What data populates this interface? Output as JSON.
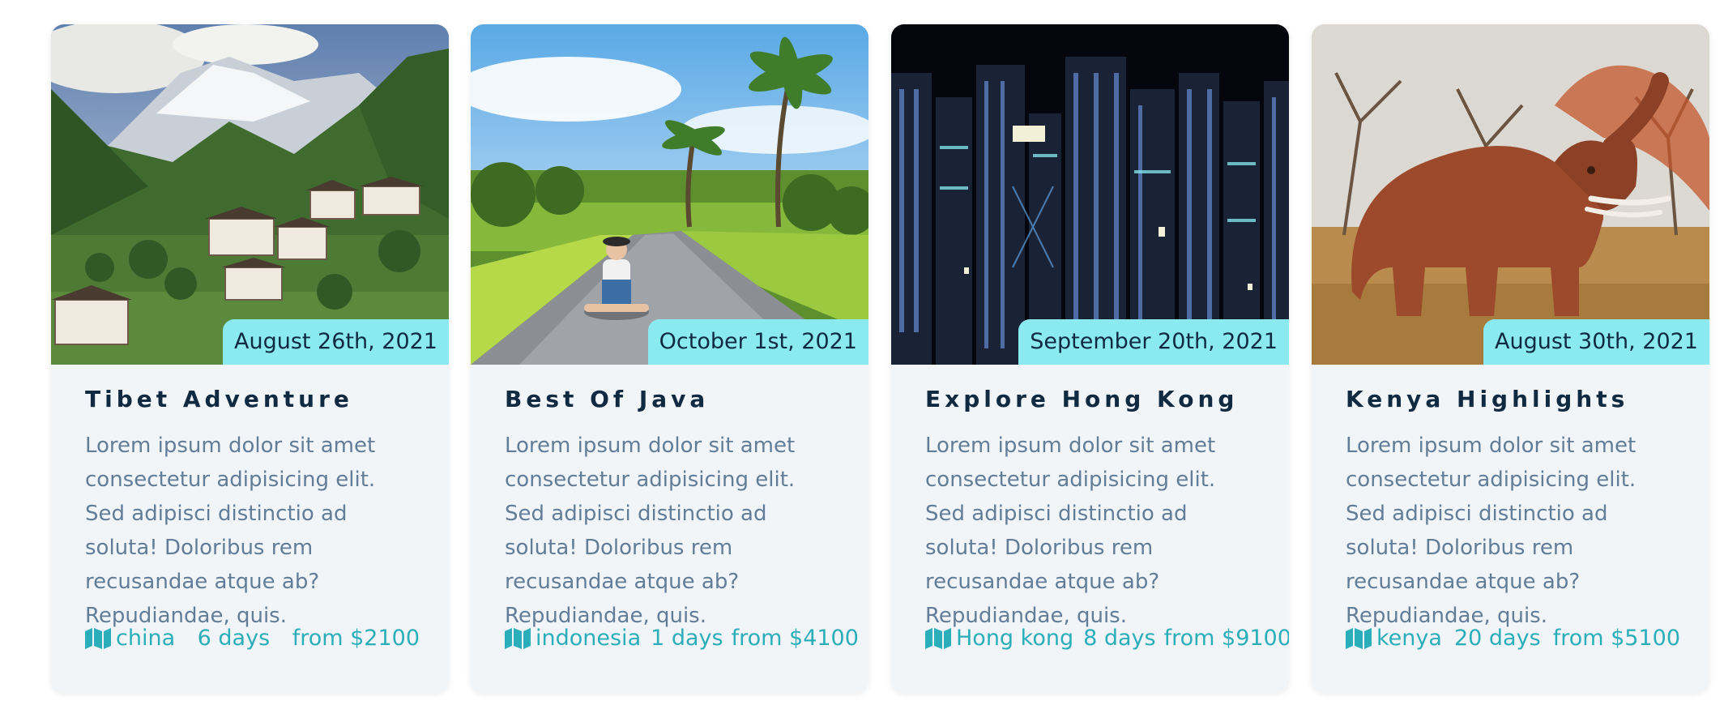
{
  "tours": [
    {
      "date": "August 26th, 2021",
      "title": "Tibet Adventure",
      "description": "Lorem ipsum dolor sit amet consectetur adipisicing elit. Sed adipisci distinctio ad soluta! Doloribus rem recusandae atque ab? Repudiandae, quis.",
      "location": "china",
      "duration": "6 days",
      "price": "from $2100",
      "image_icon": "mountain-village-image"
    },
    {
      "date": "October 1st, 2021",
      "title": "Best Of Java",
      "description": "Lorem ipsum dolor sit amet consectetur adipisicing elit. Sed adipisci distinctio ad soluta! Doloribus rem recusandae atque ab? Repudiandae, quis.",
      "location": "indonesia",
      "duration": "1 days",
      "price": "from $4100",
      "image_icon": "palm-road-image"
    },
    {
      "date": "September 20th, 2021",
      "title": "Explore Hong Kong",
      "description": "Lorem ipsum dolor sit amet consectetur adipisicing elit. Sed adipisci distinctio ad soluta! Doloribus rem recusandae atque ab? Repudiandae, quis.",
      "location": "Hong kong",
      "duration": "8 days",
      "price": "from $9100",
      "image_icon": "city-night-image"
    },
    {
      "date": "August 30th, 2021",
      "title": "Kenya Highlights",
      "description": "Lorem ipsum dolor sit amet consectetur adipisicing elit. Sed adipisci distinctio ad soluta! Doloribus rem recusandae atque ab? Repudiandae, quis.",
      "location": "kenya",
      "duration": "20 days",
      "price": "from $5100",
      "image_icon": "elephant-savanna-image"
    }
  ],
  "colors": {
    "card_bg": "#f1f5f8",
    "date_bg": "#8be9f0",
    "title": "#102a42",
    "text": "#617d98",
    "accent": "#2caeba"
  },
  "map_icon": "map-icon"
}
